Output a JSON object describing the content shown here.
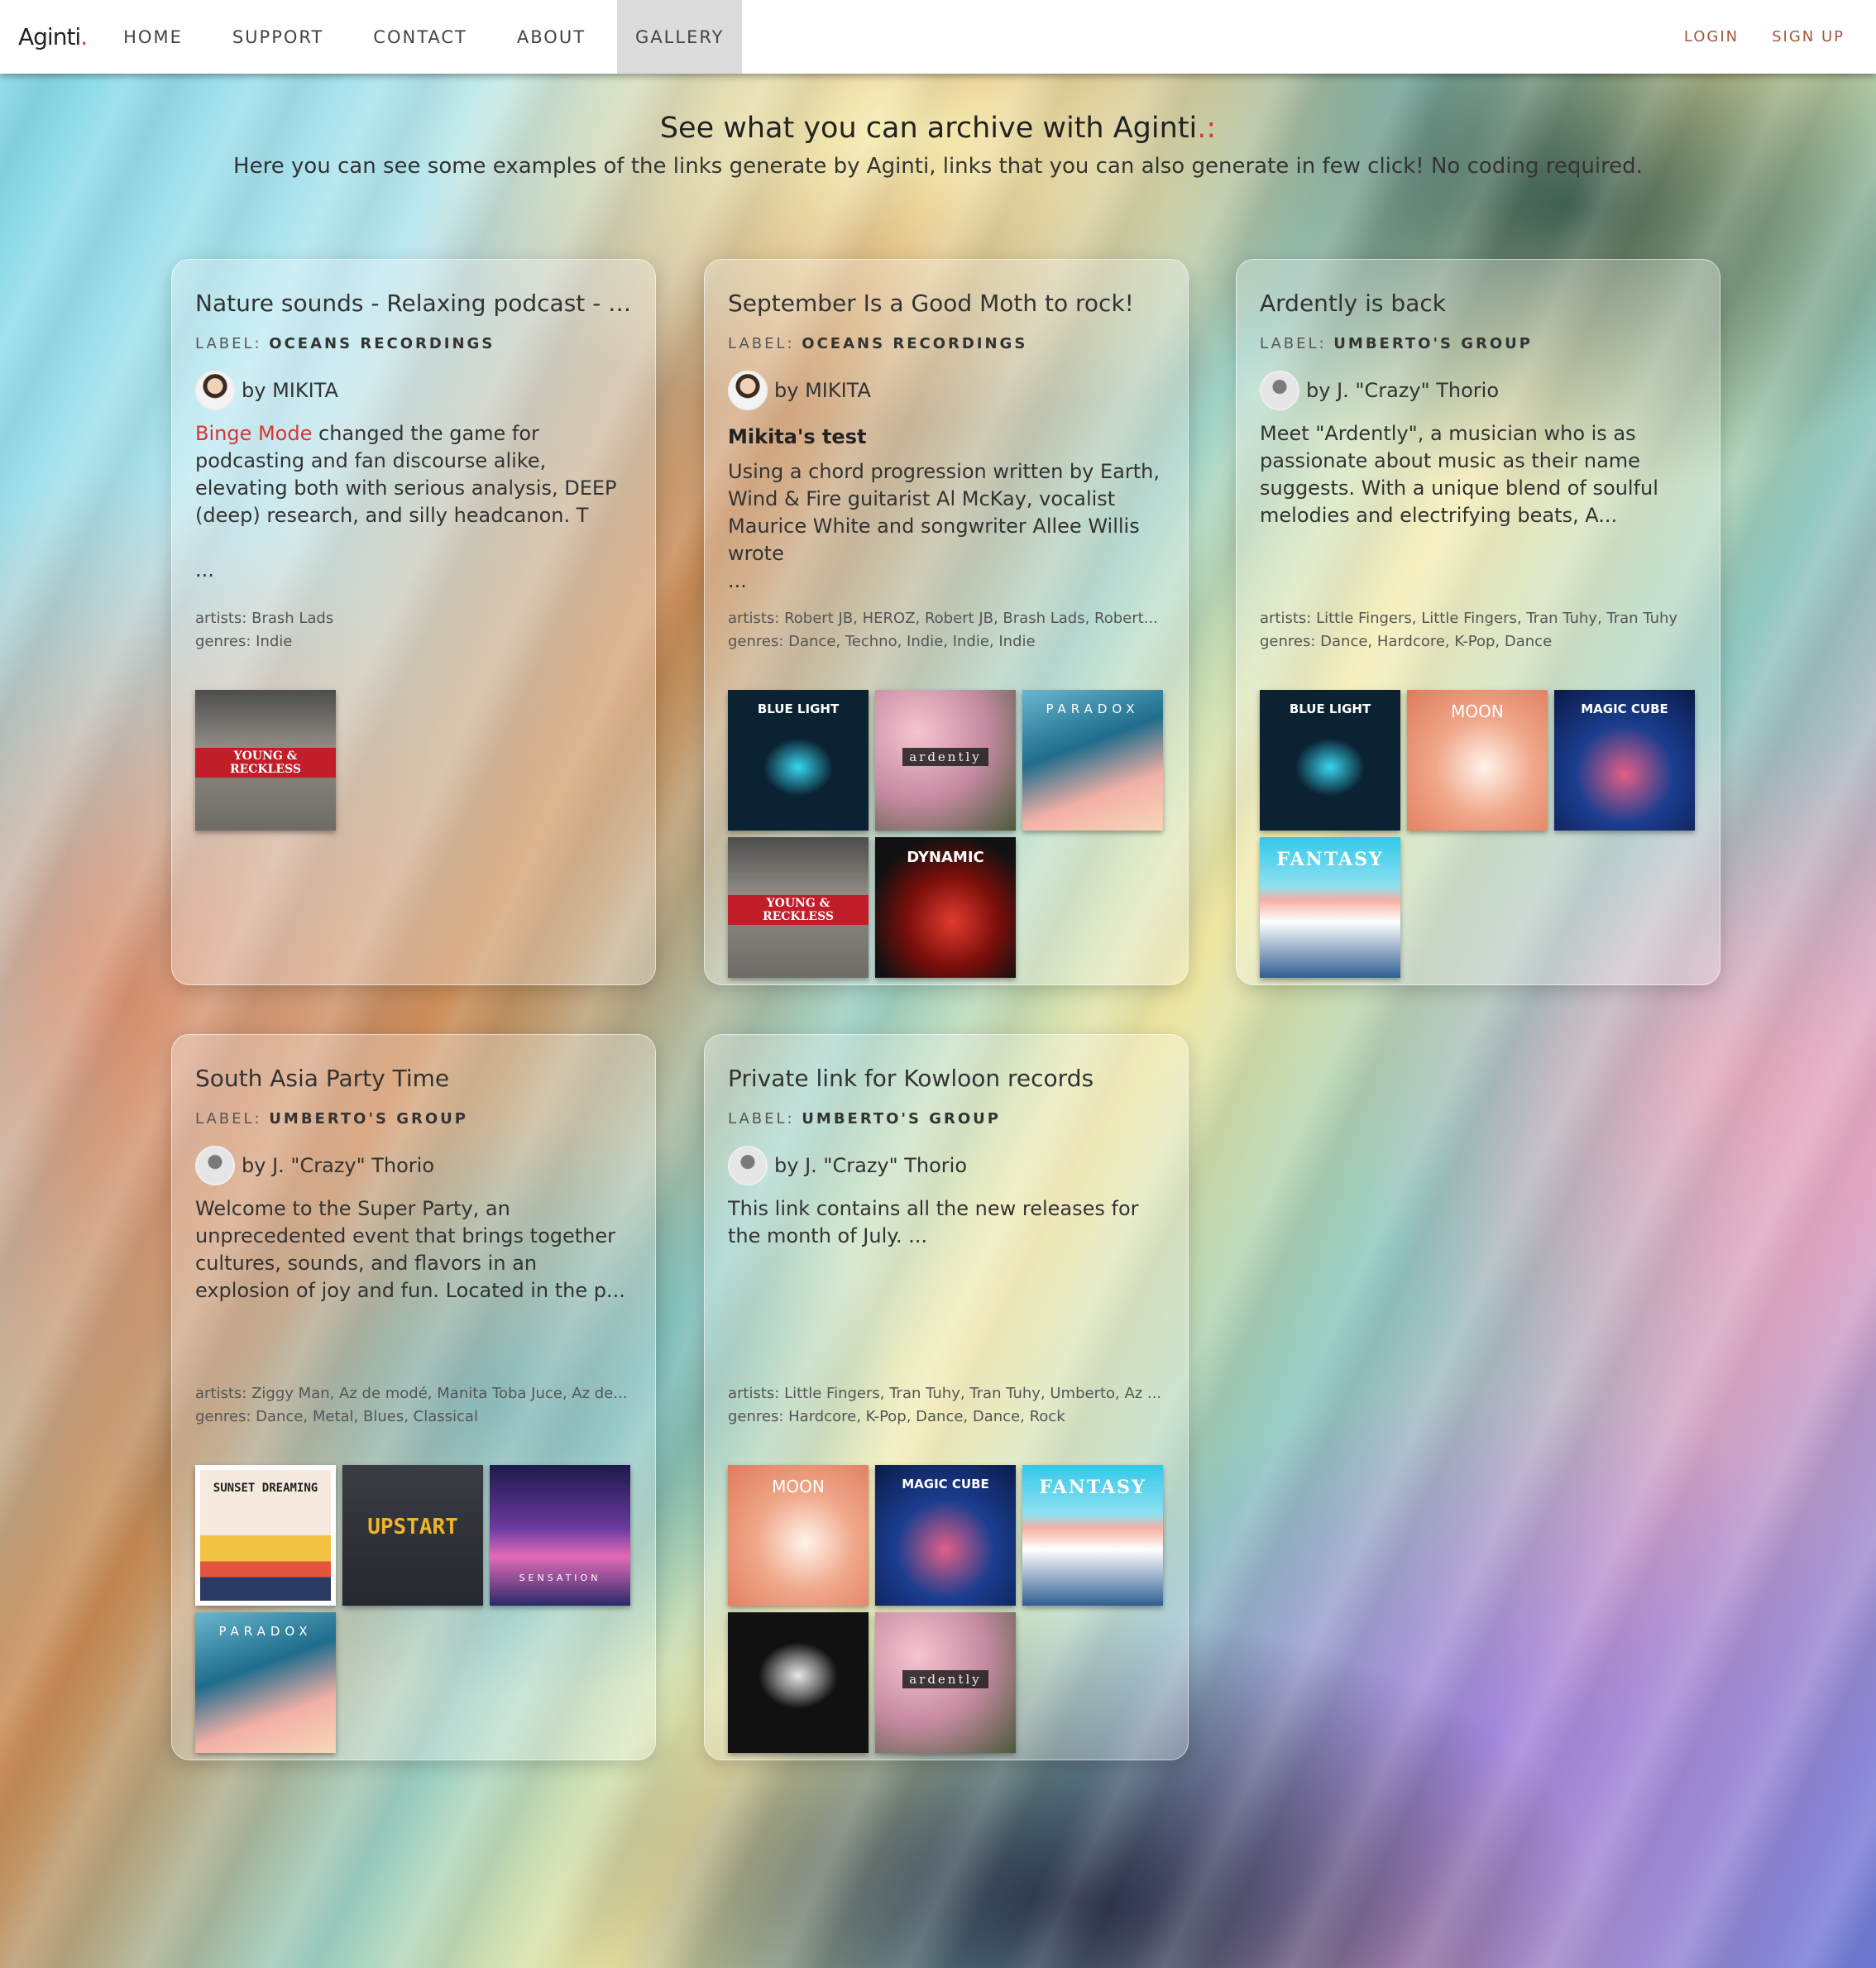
{
  "nav": {
    "brand": "Aginti",
    "brand_dot": ".",
    "items": [
      "HOME",
      "SUPPORT",
      "CONTACT",
      "ABOUT",
      "GALLERY"
    ],
    "active": "GALLERY",
    "login": "LOGIN",
    "signup": "SIGN UP"
  },
  "hero": {
    "title": "See what you can archive with Aginti",
    "title_dot": ".:",
    "subtitle": "Here you can see some examples of the links generate by Aginti, links that you can also generate in few click! No coding required."
  },
  "label_prefix": "LABEL:",
  "cards": [
    {
      "title": "Nature sounds - Relaxing podcast - J...",
      "label": "OCEANS RECORDINGS",
      "author": "by MIKITA",
      "subtitle": "",
      "desc_highlight": "Binge Mode",
      "desc": " changed the game for podcasting and fan discourse alike, elevating both with serious analysis, DEEP (deep) research, and silly headcanon. T\n\n...",
      "artists": "artists: Brash Lads",
      "genres": "genres: Indie",
      "covers": [
        "young-reckless"
      ]
    },
    {
      "title": "September Is a Good Moth to rock!",
      "label": "OCEANS RECORDINGS",
      "author": "by MIKITA",
      "subtitle": "Mikita's test",
      "desc_highlight": "",
      "desc": "Using a chord progression written by Earth, Wind & Fire guitarist Al McKay, vocalist Maurice White and songwriter Allee Willis wrote\n...",
      "artists": "artists: Robert JB, HEROZ, Robert JB, Brash Lads, Robert...",
      "genres": "genres: Dance, Techno, Indie, Indie, Indie",
      "covers": [
        "blue-light",
        "ardently",
        "paradox",
        "young-reckless",
        "dynamic"
      ]
    },
    {
      "title": "Ardently is back",
      "label": "UMBERTO'S GROUP",
      "author": "by J. \"Crazy\" Thorio",
      "subtitle": "",
      "desc_highlight": "",
      "desc": "Meet \"Ardently\", a musician who is as passionate about music as their name suggests. With a unique blend of soulful melodies and electrifying beats, A...",
      "artists": "artists: Little Fingers, Little Fingers, Tran Tuhy, Tran Tuhy",
      "genres": "genres: Dance, Hardcore, K-Pop, Dance",
      "covers": [
        "blue-light",
        "moon",
        "magic-cube",
        "fantasy"
      ]
    },
    {
      "title": "South Asia Party Time",
      "label": "UMBERTO'S GROUP",
      "author": "by J. \"Crazy\" Thorio",
      "subtitle": "",
      "desc_highlight": "",
      "desc": "Welcome to the Super Party, an unprecedented event that brings together cultures, sounds, and flavors in an explosion of joy and fun. Located in the p...",
      "artists": "artists: Ziggy Man, Az de modé, Manita Toba Juce, Az de...",
      "genres": "genres: Dance, Metal, Blues, Classical",
      "covers": [
        "sunset-dreaming",
        "upstart",
        "sensation",
        "paradox"
      ]
    },
    {
      "title": "Private link for Kowloon records",
      "label": "UMBERTO'S GROUP",
      "author": "by J. \"Crazy\" Thorio",
      "subtitle": "",
      "desc_highlight": "",
      "desc": "This link contains all the new releases for the month of July. ...",
      "artists": "artists: Little Fingers, Tran Tuhy, Tran Tuhy, Umberto, Az ...",
      "genres": "genres: Hardcore, K-Pop, Dance, Dance, Rock",
      "covers": [
        "moon",
        "magic-cube",
        "fantasy",
        "hands",
        "ardently"
      ]
    }
  ],
  "cover_texts": {
    "blue-light": "BLUE LIGHT",
    "ardently": "ardently",
    "paradox": "PARADOX",
    "young-reckless": "YOUNG & RECKLESS",
    "dynamic": "DYNAMIC",
    "moon": "MOON",
    "magic-cube": "MAGIC CUBE",
    "fantasy": "FANTASY",
    "sunset-dreaming": "SUNSET DREAMING",
    "upstart": "UPSTART",
    "sensation": "SENSATION",
    "hands": ""
  }
}
